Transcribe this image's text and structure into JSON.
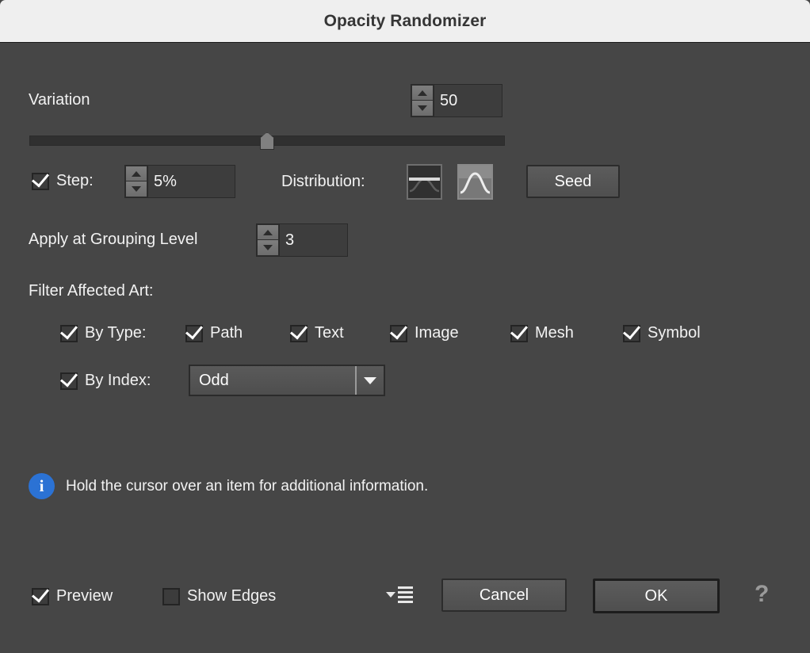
{
  "window": {
    "title": "Opacity Randomizer"
  },
  "variation": {
    "label": "Variation",
    "value": "50",
    "slider_percent": 50
  },
  "step": {
    "label": "Step:",
    "checked": true,
    "value": "5%"
  },
  "distribution": {
    "label": "Distribution:",
    "options": [
      {
        "name": "uniform-distribution",
        "selected": false
      },
      {
        "name": "gaussian-distribution",
        "selected": true
      }
    ]
  },
  "seed": {
    "label": "Seed"
  },
  "grouping": {
    "label": "Apply at Grouping Level",
    "value": "3"
  },
  "filter": {
    "title": "Filter Affected Art:",
    "by_type": {
      "label": "By Type:",
      "checked": true,
      "items": [
        {
          "label": "Path",
          "checked": true
        },
        {
          "label": "Text",
          "checked": true
        },
        {
          "label": "Image",
          "checked": true
        },
        {
          "label": "Mesh",
          "checked": true
        },
        {
          "label": "Symbol",
          "checked": true
        }
      ]
    },
    "by_index": {
      "label": "By Index:",
      "checked": true,
      "value": "Odd"
    }
  },
  "info": {
    "icon": "info-icon",
    "message": "Hold the cursor over an item for additional information."
  },
  "footer": {
    "preview": {
      "label": "Preview",
      "checked": true
    },
    "show_edges": {
      "label": "Show Edges",
      "checked": false
    },
    "flyout_menu": "flyout-menu-icon",
    "cancel": "Cancel",
    "ok": "OK",
    "help": "?"
  },
  "colors": {
    "titlebar_bg": "#efefef",
    "dialog_bg": "#464646",
    "info_blue": "#2b72d4",
    "text": "#f2f2f2"
  }
}
